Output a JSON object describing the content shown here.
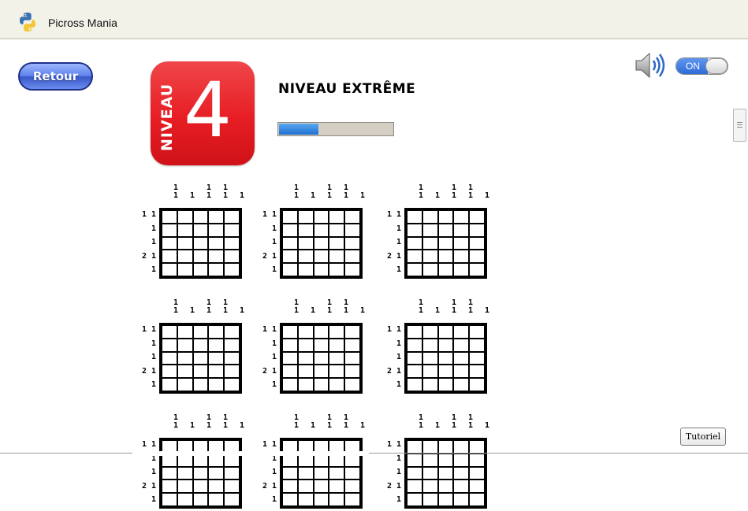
{
  "window": {
    "title": "Picross Mania",
    "icon": "python-logo-icon"
  },
  "nav": {
    "back_label": "Retour"
  },
  "level": {
    "vertical_label": "NIVEAU",
    "number": "4",
    "title": "NIVEAU EXTRÊME",
    "progress": 0.34
  },
  "sound": {
    "icon": "speaker-icon",
    "toggle_label": "ON",
    "enabled": true
  },
  "tutorial": {
    "label": "Tutoriel"
  },
  "puzzle_template": {
    "top_clues": [
      [
        "1",
        "1"
      ],
      [
        "1"
      ],
      [
        "1",
        "1"
      ],
      [
        "1",
        "1"
      ],
      [
        "1"
      ]
    ],
    "left_clues": [
      "1 1",
      "1",
      "1",
      "2 1",
      "1"
    ]
  },
  "colors": {
    "accent_red": "#e61e24",
    "button_blue": "#3a57c7",
    "progress_blue": "#1f6fd0"
  }
}
